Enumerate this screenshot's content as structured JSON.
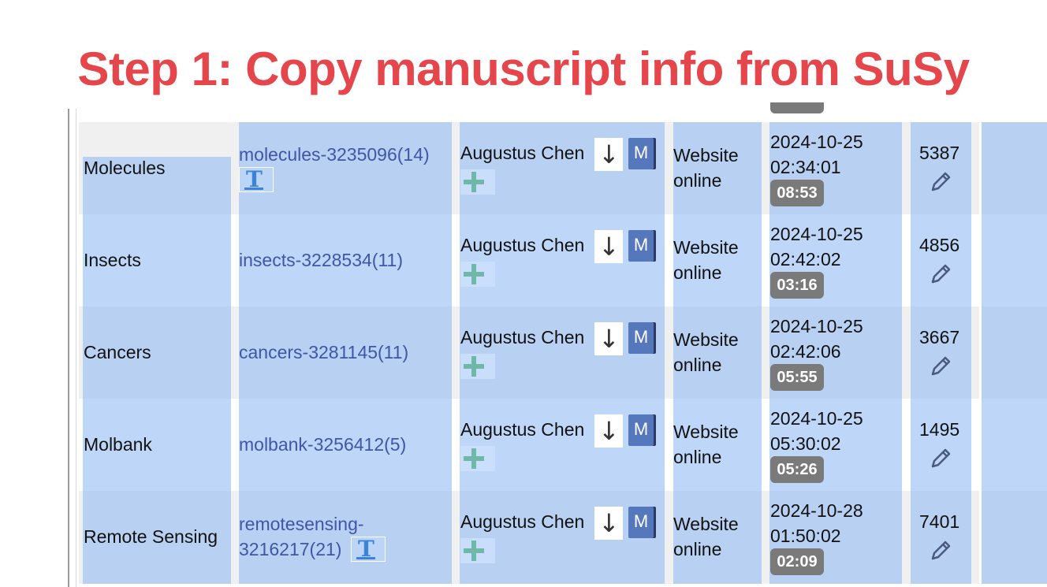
{
  "title": "Step 1: Copy manuscript info from SuSy",
  "colors": {
    "title": "#e5464b",
    "selection": "#96bef5",
    "link": "#3f56a8",
    "badge": "#7a7a7a",
    "m_button": "#5577bb"
  },
  "rows": [
    {
      "journal": "Molecules",
      "manuscript": "molecules-3235096(14)",
      "manuscript_line2": "",
      "has_t_icon": true,
      "editor": "Augustus Chen",
      "m_label": "M",
      "status_line1": "Website",
      "status_line2": "online",
      "date": "2024-10-25",
      "time": "02:34:01",
      "badge": "08:53",
      "count": "5387"
    },
    {
      "journal": "Insects",
      "manuscript": "insects-3228534(11)",
      "manuscript_line2": "",
      "has_t_icon": false,
      "editor": "Augustus Chen",
      "m_label": "M",
      "status_line1": "Website",
      "status_line2": "online",
      "date": "2024-10-25",
      "time": "02:42:02",
      "badge": "03:16",
      "count": "4856"
    },
    {
      "journal": "Cancers",
      "manuscript": "cancers-3281145(11)",
      "manuscript_line2": "",
      "has_t_icon": false,
      "editor": "Augustus Chen",
      "m_label": "M",
      "status_line1": "Website",
      "status_line2": "online",
      "date": "2024-10-25",
      "time": "02:42:06",
      "badge": "05:55",
      "count": "3667"
    },
    {
      "journal": "Molbank",
      "manuscript": "molbank-3256412(5)",
      "manuscript_line2": "",
      "has_t_icon": false,
      "editor": "Augustus Chen",
      "m_label": "M",
      "status_line1": "Website",
      "status_line2": "online",
      "date": "2024-10-25",
      "time": "05:30:02",
      "badge": "05:26",
      "count": "1495"
    },
    {
      "journal": "Remote Sensing",
      "manuscript": "remotesensing-",
      "manuscript_line2": "3216217(21)",
      "has_t_icon": true,
      "editor": "Augustus Chen",
      "m_label": "M",
      "status_line1": "Website",
      "status_line2": "online",
      "date": "2024-10-28",
      "time": "01:50:02",
      "badge": "02:09",
      "count": "7401"
    }
  ]
}
